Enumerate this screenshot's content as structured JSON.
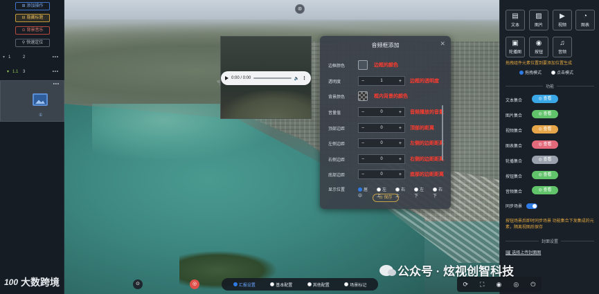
{
  "left_panel": {
    "buttons": {
      "add": "添加操作",
      "hide": "隐藏标题",
      "music": "背景音乐",
      "locate": "快速定位"
    },
    "tree": [
      {
        "caret": "▾",
        "label": "1",
        "num": "2",
        "dots": "•••"
      },
      {
        "caret": "▾",
        "label": "1.1",
        "num": "3",
        "dots": "•••"
      }
    ],
    "thumbnail": {
      "dots": "•••",
      "caption": "①"
    }
  },
  "logo": {
    "mark": "100",
    "text": "大数跨境"
  },
  "top_toggle": "⊗",
  "video": {
    "time": "0:00 / 0:00"
  },
  "dialog": {
    "title": "音频框添加",
    "close": "✕",
    "rows": [
      {
        "label": "边框颜色",
        "note": "边框的颜色"
      },
      {
        "label": "透明度",
        "value": "1",
        "note": "边框的透明度"
      },
      {
        "label": "背景颜色",
        "note": "框内背景的颜色"
      },
      {
        "label": "音量值",
        "value": "0",
        "note": "音频播放的音量"
      },
      {
        "label": "顶部边距",
        "value": "0",
        "note": "顶部的距离"
      },
      {
        "label": "左侧边距",
        "value": "0",
        "note": "左侧的边距距离"
      },
      {
        "label": "右侧边距",
        "value": "0",
        "note": "右侧的边距距离"
      },
      {
        "label": "底部边距",
        "value": "0",
        "note": "底部的边距距离"
      }
    ],
    "stepper": {
      "minus": "−",
      "plus": "+"
    },
    "position": {
      "label": "显示位置",
      "options": [
        "居中",
        "左上",
        "右上",
        "左下",
        "右下"
      ]
    },
    "save": "保存"
  },
  "right_panel": {
    "tiles": {
      "text": {
        "label": "文本",
        "glyph": "▤"
      },
      "image": {
        "label": "图片",
        "glyph": "▨"
      },
      "video": {
        "label": "视频",
        "glyph": "▶"
      },
      "chart": {
        "label": "图表",
        "glyph": "◔"
      },
      "carousel": {
        "label": "轮播图",
        "glyph": "▣"
      },
      "button": {
        "label": "按钮",
        "glyph": "◉"
      },
      "audio": {
        "label": "音频",
        "glyph": "♫"
      }
    },
    "drag_hint": "拖拽组件元素位置到要添加位置生成",
    "modes": [
      "拖拽模式",
      "点击模式"
    ],
    "func_title": "功能",
    "collections": [
      {
        "label": "文本集合",
        "pill": "◎ 查看",
        "color": "#3aa7e6"
      },
      {
        "label": "图片集合",
        "pill": "◎ 查看",
        "color": "#61c36a"
      },
      {
        "label": "视频集合",
        "pill": "◎ 查看",
        "color": "#e8a64a"
      },
      {
        "label": "图表集合",
        "pill": "◎ 查看",
        "color": "#e26a7b"
      },
      {
        "label": "轮播集合",
        "pill": "◎ 查看",
        "color": "#9aa3ad"
      },
      {
        "label": "按钮集合",
        "pill": "◎ 查看",
        "color": "#61c36a"
      },
      {
        "label": "音频集合",
        "pill": "◎ 查看",
        "color": "#61c36a"
      }
    ],
    "sync_label": "同步场景",
    "sync_toggle": "开",
    "sync_note": "按钮场景后即时同步场景 功能集合下发集成的元素，隔离视图后保存",
    "cover_title": "封面设置",
    "upload": "选择上传封面图"
  },
  "bottom": {
    "round_dark": "⊙",
    "round_red": "◎",
    "tabs": [
      {
        "label": "汇报设置",
        "active": true
      },
      {
        "label": "基本配置",
        "active": false
      },
      {
        "label": "其他配置",
        "active": false
      },
      {
        "label": "场景标记",
        "active": false
      }
    ],
    "tools": [
      "⟳",
      "⛶",
      "◉",
      "◎",
      "⏻"
    ]
  },
  "watermark": "公众号 · 炫视创智科技"
}
